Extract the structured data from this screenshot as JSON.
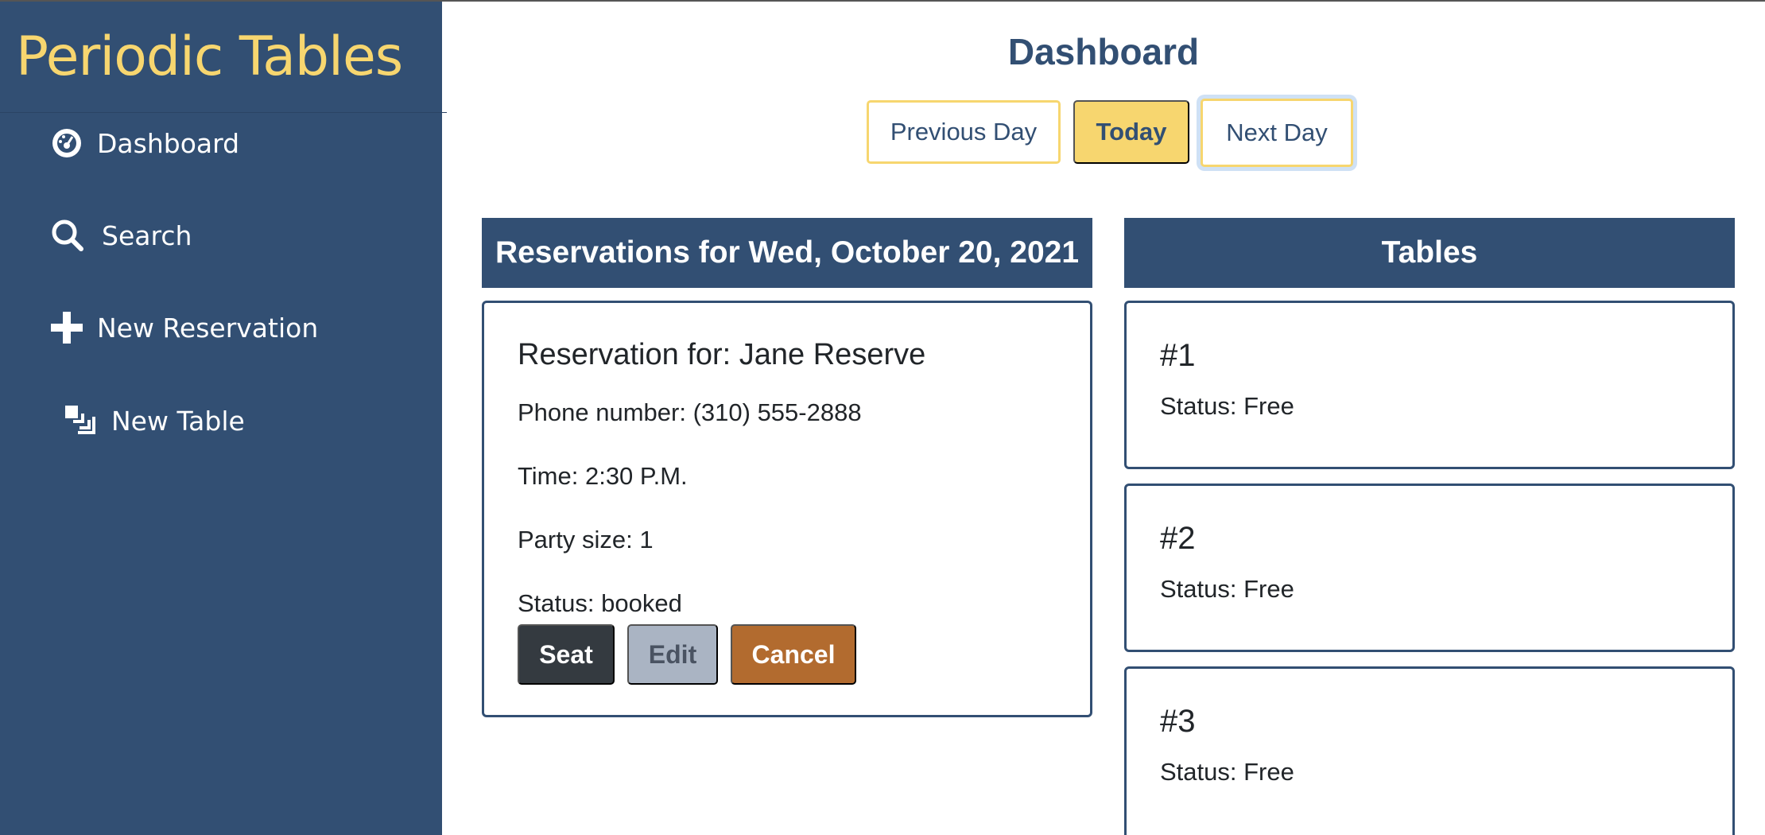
{
  "app": {
    "brand": "Periodic Tables"
  },
  "sidebar": {
    "items": [
      {
        "label": "Dashboard",
        "icon": "dashboard-gauge-icon"
      },
      {
        "label": "Search",
        "icon": "search-icon"
      },
      {
        "label": "New Reservation",
        "icon": "plus-icon"
      },
      {
        "label": "New Table",
        "icon": "layers-icon"
      }
    ]
  },
  "main": {
    "title": "Dashboard",
    "day_nav": {
      "previous": "Previous Day",
      "today": "Today",
      "next": "Next Day"
    },
    "reservations": {
      "header": "Reservations for Wed, October 20, 2021",
      "items": [
        {
          "name": "Reservation for: Jane Reserve",
          "phone": "Phone number: (310) 555-2888",
          "time": "Time: 2:30 P.M.",
          "party": "Party size: 1",
          "status": "Status: booked",
          "actions": {
            "seat": "Seat",
            "edit": "Edit",
            "cancel": "Cancel"
          }
        }
      ]
    },
    "tables": {
      "header": "Tables",
      "items": [
        {
          "name": "#1",
          "status": "Status: Free"
        },
        {
          "name": "#2",
          "status": "Status: Free"
        },
        {
          "name": "#3",
          "status": "Status: Free"
        }
      ]
    }
  },
  "colors": {
    "sidebar_bg": "#324f73",
    "brand": "#f7d66f",
    "accent_yellow": "#f7d66f",
    "seat_btn": "#343a40",
    "edit_btn": "#aab4c3",
    "cancel_btn": "#b26b2f"
  }
}
